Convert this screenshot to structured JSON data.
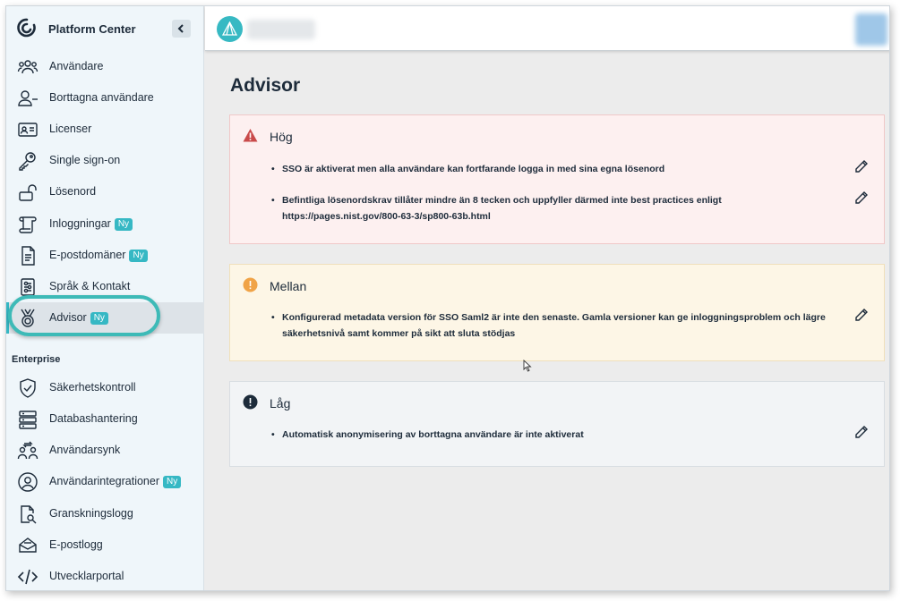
{
  "sidebar": {
    "brand_title": "Platform Center",
    "items": [
      {
        "label": "Användare",
        "icon": "users-icon"
      },
      {
        "label": "Borttagna användare",
        "icon": "user-minus-icon"
      },
      {
        "label": "Licenser",
        "icon": "id-card-icon"
      },
      {
        "label": "Single sign-on",
        "icon": "key-icon"
      },
      {
        "label": "Lösenord",
        "icon": "unlocked-padlock-icon"
      },
      {
        "label": "Inloggningar",
        "icon": "scroll-icon",
        "badge": "Ny"
      },
      {
        "label": "E-postdomäner",
        "icon": "document-icon",
        "badge": "Ny"
      },
      {
        "label": "Språk & Kontakt",
        "icon": "settings-sliders-icon"
      },
      {
        "label": "Advisor",
        "icon": "medal-icon",
        "badge": "Ny",
        "active": true
      }
    ],
    "section_label": "Enterprise",
    "enterprise_items": [
      {
        "label": "Säkerhetskontroll",
        "icon": "shield-check-icon"
      },
      {
        "label": "Databashantering",
        "icon": "database-icon"
      },
      {
        "label": "Användarsynk",
        "icon": "user-sync-icon"
      },
      {
        "label": "Användarintegrationer",
        "icon": "user-circle-icon",
        "badge": "Ny"
      },
      {
        "label": "Granskningslogg",
        "icon": "document-search-icon"
      },
      {
        "label": "E-postlogg",
        "icon": "mail-log-icon"
      },
      {
        "label": "Utvecklarportal",
        "icon": "code-icon"
      }
    ]
  },
  "main": {
    "page_title": "Advisor",
    "cards": [
      {
        "severity": "high",
        "title": "Hög",
        "icon": "warning-triangle-icon",
        "color": "#c94a4a",
        "recommendations": [
          "SSO är aktiverat men alla användare kan fortfarande logga in med sina egna lösenord",
          "Befintliga lösenordskrav tillåter mindre än 8 tecken och uppfyller därmed inte best practices enligt https://pages.nist.gov/800-63-3/sp800-63b.html"
        ]
      },
      {
        "severity": "medium",
        "title": "Mellan",
        "icon": "exclamation-circle-icon",
        "color": "#f0a347",
        "recommendations": [
          "Konfigurerad metadata version för SSO Saml2 är inte den senaste. Gamla versioner kan ge inloggningsproblem och lägre säkerhetsnivå samt kommer på sikt att sluta stödjas"
        ]
      },
      {
        "severity": "low",
        "title": "Låg",
        "icon": "exclamation-circle-icon",
        "color": "#1d2b3a",
        "recommendations": [
          "Automatisk anonymisering av borttagna användare är inte aktiverat"
        ]
      }
    ]
  },
  "colors": {
    "accent": "#36b8c4",
    "sidebar_bg": "#eff6fa",
    "content_bg": "#ececec"
  }
}
